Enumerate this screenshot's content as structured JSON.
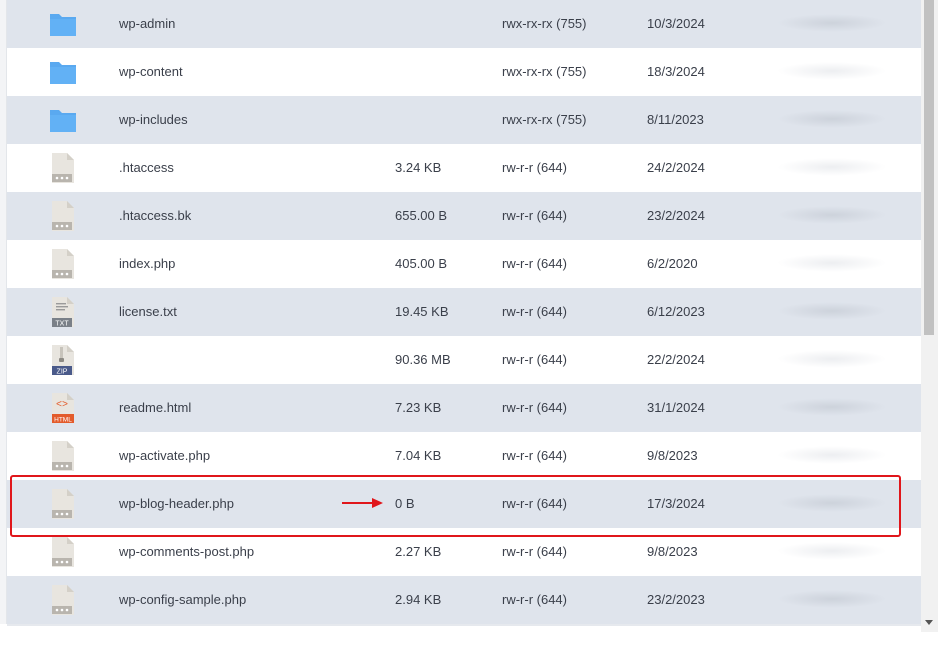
{
  "files": [
    {
      "name": "wp-admin",
      "size": "",
      "permissions": "rwx-rx-rx (755)",
      "date": "10/3/2024",
      "icon": "folder-icon",
      "type": "folder"
    },
    {
      "name": "wp-content",
      "size": "",
      "permissions": "rwx-rx-rx (755)",
      "date": "18/3/2024",
      "icon": "folder-icon",
      "type": "folder"
    },
    {
      "name": "wp-includes",
      "size": "",
      "permissions": "rwx-rx-rx (755)",
      "date": "8/11/2023",
      "icon": "folder-icon",
      "type": "folder"
    },
    {
      "name": ".htaccess",
      "size": "3.24 KB",
      "permissions": "rw-r-r (644)",
      "date": "24/2/2024",
      "icon": "file-icon",
      "type": "file"
    },
    {
      "name": ".htaccess.bk",
      "size": "655.00 B",
      "permissions": "rw-r-r (644)",
      "date": "23/2/2024",
      "icon": "file-icon",
      "type": "file"
    },
    {
      "name": "index.php",
      "size": "405.00 B",
      "permissions": "rw-r-r (644)",
      "date": "6/2/2020",
      "icon": "file-icon",
      "type": "file"
    },
    {
      "name": "license.txt",
      "size": "19.45 KB",
      "permissions": "rw-r-r (644)",
      "date": "6/12/2023",
      "icon": "txt-file-icon",
      "type": "txt",
      "badge": "TXT"
    },
    {
      "name": "",
      "size": "90.36 MB",
      "permissions": "rw-r-r (644)",
      "date": "22/2/2024",
      "icon": "zip-file-icon",
      "type": "zip",
      "badge": "ZIP"
    },
    {
      "name": "readme.html",
      "size": "7.23 KB",
      "permissions": "rw-r-r (644)",
      "date": "31/1/2024",
      "icon": "html-file-icon",
      "type": "html",
      "badge": "HTML"
    },
    {
      "name": "wp-activate.php",
      "size": "7.04 KB",
      "permissions": "rw-r-r (644)",
      "date": "9/8/2023",
      "icon": "file-icon",
      "type": "file"
    },
    {
      "name": "wp-blog-header.php",
      "size": "0 B",
      "permissions": "rw-r-r (644)",
      "date": "17/3/2024",
      "icon": "file-icon",
      "type": "file"
    },
    {
      "name": "wp-comments-post.php",
      "size": "2.27 KB",
      "permissions": "rw-r-r (644)",
      "date": "9/8/2023",
      "icon": "file-icon",
      "type": "file"
    },
    {
      "name": "wp-config-sample.php",
      "size": "2.94 KB",
      "permissions": "rw-r-r (644)",
      "date": "23/2/2023",
      "icon": "file-icon",
      "type": "file"
    }
  ],
  "highlighted_file": "wp-blog-header.php",
  "colors": {
    "row_shade": "#dfe4ec",
    "row_plain": "#ffffff",
    "folder": "#5aa9f0",
    "file": "#e8e5df",
    "annotation": "#e0161b",
    "zip": "#4a5a8a",
    "html": "#e35b2b",
    "txt": "#7a8088"
  }
}
